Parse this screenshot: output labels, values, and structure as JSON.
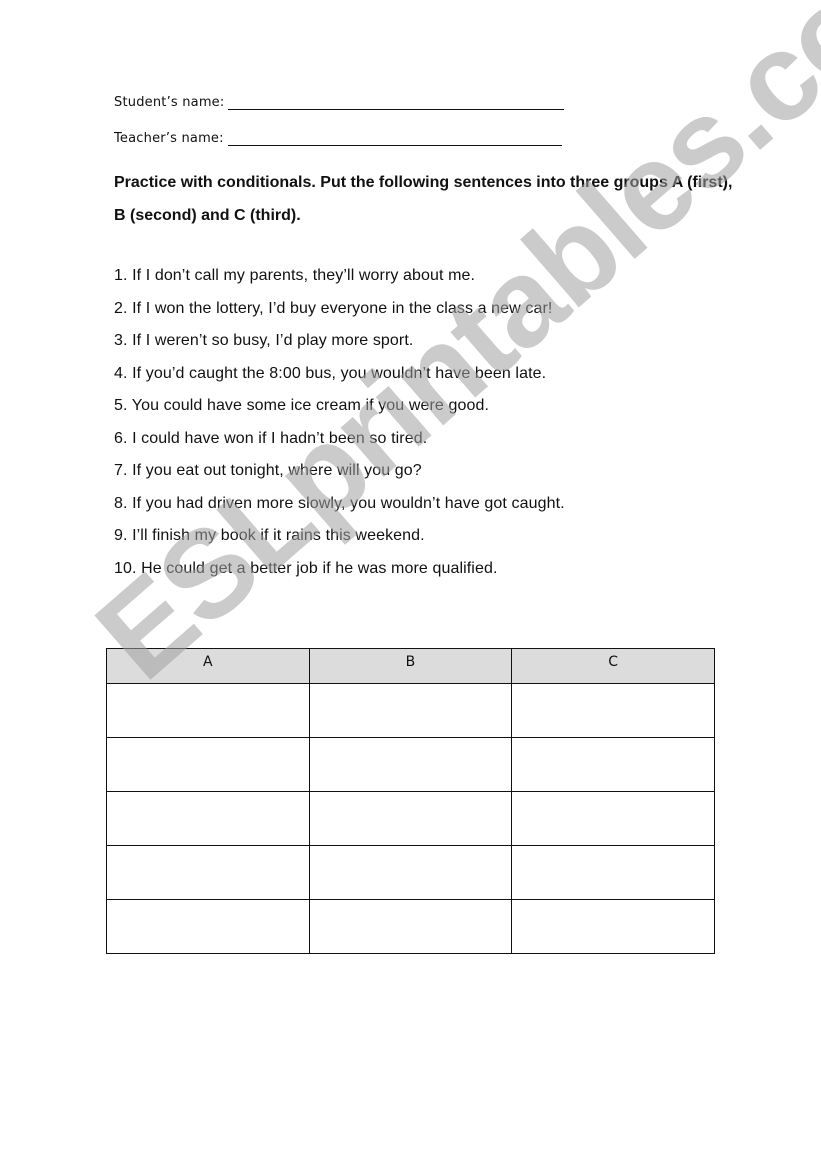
{
  "header": {
    "student_label": "Student’s name:",
    "teacher_label": "Teacher’s name:"
  },
  "instruction": "Practice with conditionals. Put the following sentences into three groups A (first), B (second) and C (third).",
  "sentences": [
    "1. If I don’t call my parents, they’ll worry about me.",
    "2. If I won the lottery, I’d buy everyone in the class a new car!",
    "3. If I weren’t so busy, I’d play more sport.",
    "4. If you’d caught the 8:00 bus, you wouldn’t have been late.",
    "5. You could have some ice cream if you were good.",
    "6. I could have won if I hadn’t been so tired.",
    "7. If you eat out tonight, where will you go?",
    "8. If you had driven more slowly, you wouldn’t have got caught.",
    "9. I’ll finish my book if it rains this weekend.",
    "10. He could get a better job if he was more qualified."
  ],
  "table": {
    "headers": [
      "A",
      "B",
      "C"
    ],
    "empty_rows": 5
  },
  "watermark": "ESLprintables.com"
}
